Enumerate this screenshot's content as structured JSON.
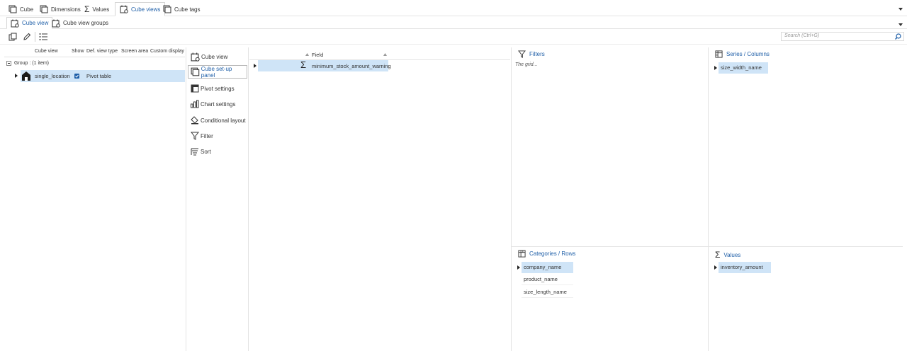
{
  "tabs": [
    {
      "label": "Cube",
      "icon": "cube-icon"
    },
    {
      "label": "Dimensions",
      "icon": "dimensions-icon"
    },
    {
      "label": "Values",
      "icon": "sigma-icon"
    },
    {
      "label": "Cube views",
      "icon": "cube-view-icon",
      "active": true
    },
    {
      "label": "Cube tags",
      "icon": "cube-tags-icon"
    }
  ],
  "subtabs": [
    {
      "label": "Cube view",
      "active": true
    },
    {
      "label": "Cube view groups"
    }
  ],
  "search": {
    "placeholder": "Search (Ctrl+G)"
  },
  "grid": {
    "columns": [
      "Cube view",
      "Show",
      "Def. view type",
      "Screen area",
      "Custom display"
    ],
    "group_label": "Group :  (1 item)",
    "rows": [
      {
        "name": "single_location",
        "show": true,
        "view_type": "Pivot table"
      }
    ]
  },
  "menu": {
    "items": [
      "Cube view",
      "Cube set-up panel",
      "Pivot settings",
      "Chart settings",
      "Conditional layout",
      "Filter",
      "Sort"
    ],
    "active": "Cube set-up panel"
  },
  "fields": {
    "header": "Field",
    "rows": [
      "minimum_stock_amount_warning"
    ]
  },
  "filters": {
    "title": "Filters",
    "placeholder": "The grid..."
  },
  "series": {
    "title": "Series / Columns",
    "items": [
      "size_width_name"
    ]
  },
  "categories": {
    "title": "Categories / Rows",
    "items": [
      "company_name",
      "product_name",
      "size_length_name"
    ]
  },
  "values": {
    "title": "Values",
    "items": [
      "inventory_amount"
    ]
  },
  "colors": {
    "accent": "#1f5fa8",
    "selection": "#cfe4f7",
    "checkbox": "#1f5fa8"
  }
}
